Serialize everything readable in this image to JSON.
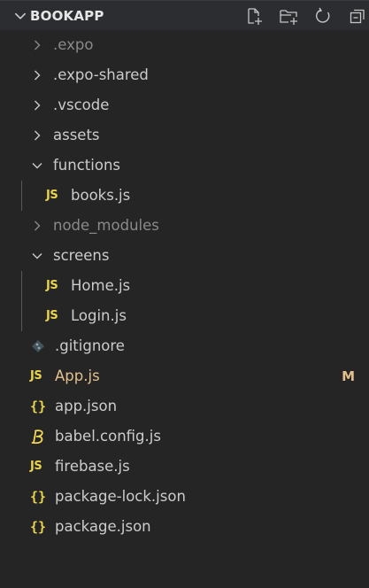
{
  "header": {
    "title": "BOOKAPP",
    "actions": [
      "new-file-icon",
      "new-folder-icon",
      "refresh-icon",
      "collapse-all-icon"
    ]
  },
  "tree": [
    {
      "id": "expo",
      "label": ".expo",
      "type": "folder",
      "expanded": false,
      "depth": 1,
      "dimmed": true
    },
    {
      "id": "expo-shared",
      "label": ".expo-shared",
      "type": "folder",
      "expanded": false,
      "depth": 1
    },
    {
      "id": "vscode",
      "label": ".vscode",
      "type": "folder",
      "expanded": false,
      "depth": 1
    },
    {
      "id": "assets",
      "label": "assets",
      "type": "folder",
      "expanded": false,
      "depth": 1
    },
    {
      "id": "functions",
      "label": "functions",
      "type": "folder",
      "expanded": true,
      "depth": 1
    },
    {
      "id": "books-js",
      "label": "books.js",
      "type": "js",
      "depth": 2
    },
    {
      "id": "node-modules",
      "label": "node_modules",
      "type": "folder",
      "expanded": false,
      "depth": 1,
      "dimmed": true
    },
    {
      "id": "screens",
      "label": "screens",
      "type": "folder",
      "expanded": true,
      "depth": 1
    },
    {
      "id": "home-js",
      "label": "Home.js",
      "type": "js",
      "depth": 2
    },
    {
      "id": "login-js",
      "label": "Login.js",
      "type": "js",
      "depth": 2
    },
    {
      "id": "gitignore",
      "label": ".gitignore",
      "type": "git",
      "depth": 1
    },
    {
      "id": "app-js",
      "label": "App.js",
      "type": "js",
      "depth": 1,
      "modified": true,
      "badge": "M"
    },
    {
      "id": "app-json",
      "label": "app.json",
      "type": "json",
      "depth": 1
    },
    {
      "id": "babel-config-js",
      "label": "babel.config.js",
      "type": "babel",
      "depth": 1
    },
    {
      "id": "firebase-js",
      "label": "firebase.js",
      "type": "js",
      "depth": 1
    },
    {
      "id": "package-lock-json",
      "label": "package-lock.json",
      "type": "json",
      "depth": 1
    },
    {
      "id": "package-json",
      "label": "package.json",
      "type": "json",
      "depth": 1
    }
  ],
  "icon_glyphs": {
    "js": "JS",
    "json": "{}"
  },
  "colors": {
    "sidebar_bg": "#252526",
    "header_bg": "#2b2d30",
    "text": "#cccccc",
    "dimmed_text": "#8a8a8a",
    "modified_text": "#e2c08d",
    "js_icon": "#e8d44d",
    "json_icon": "#e8d44d",
    "babel_icon": "#f5da55",
    "git_icon": "#41535b"
  }
}
